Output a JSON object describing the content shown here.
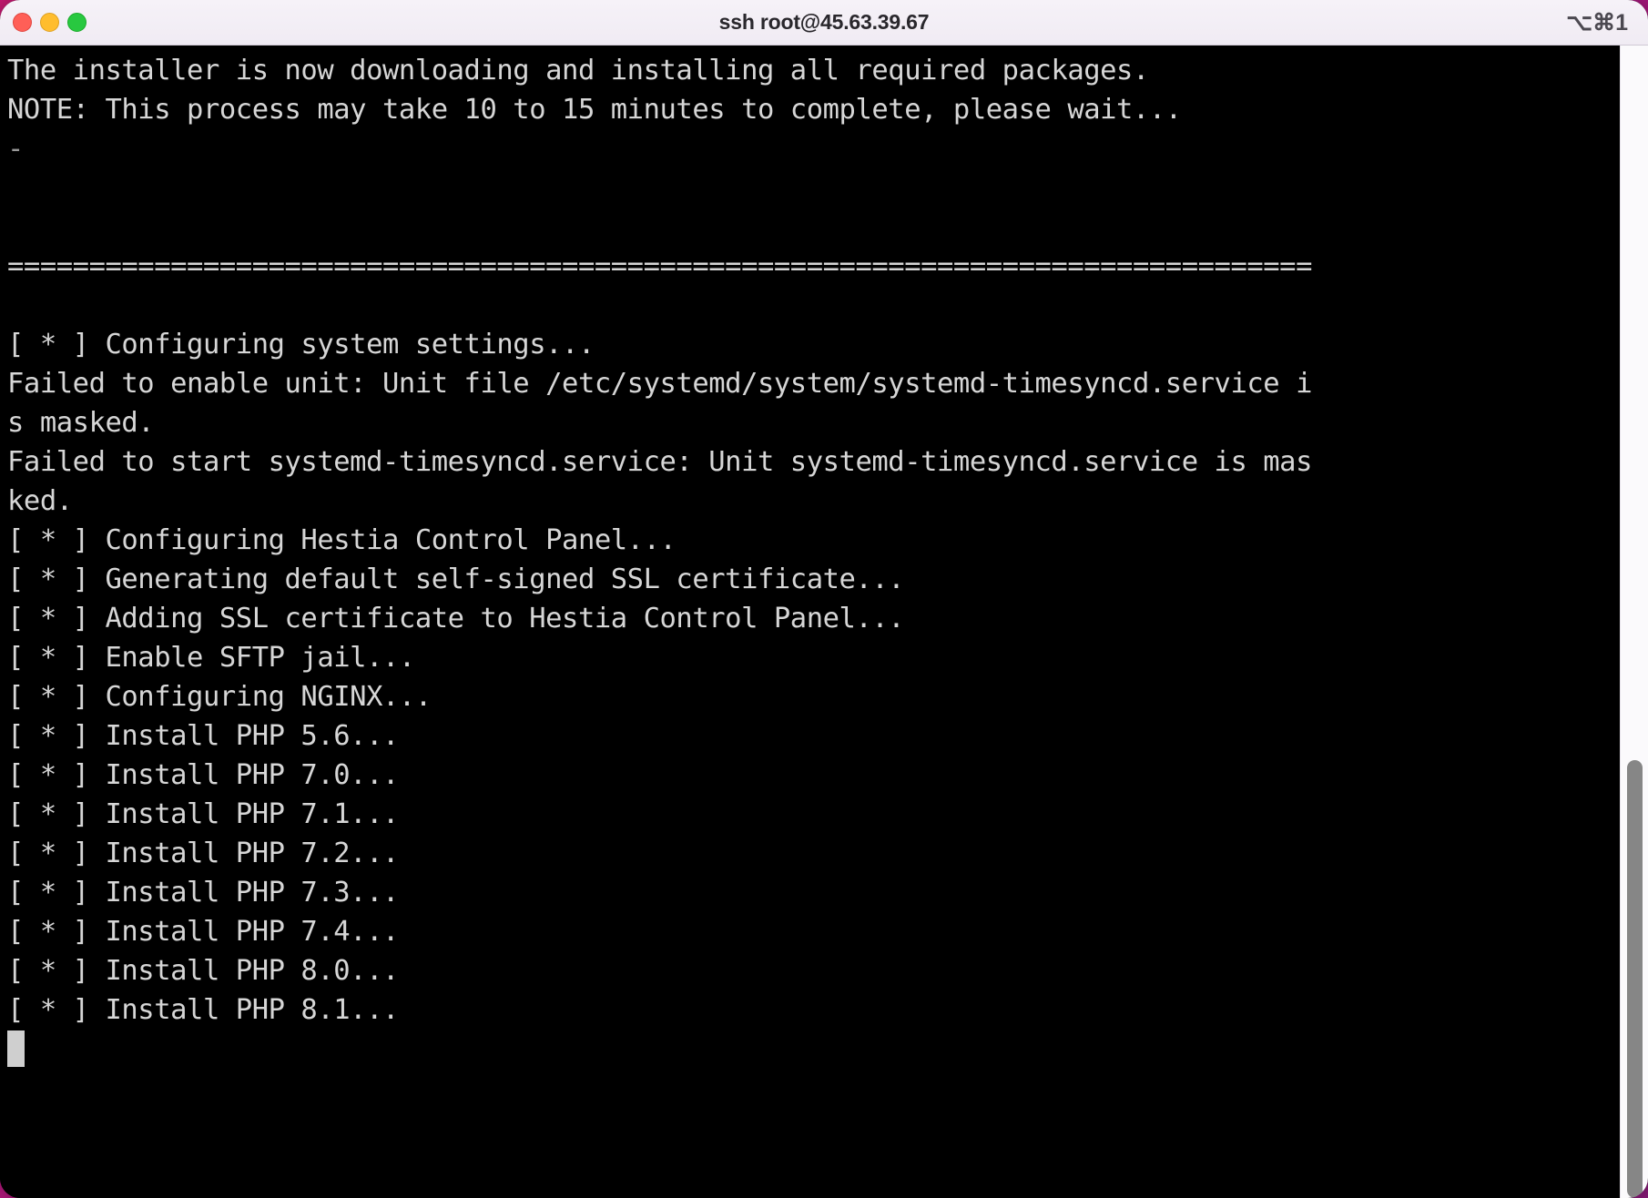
{
  "window": {
    "title": "ssh root@45.63.39.67",
    "shortcut": "⌥⌘1",
    "traffic_lights": [
      {
        "name": "close-button",
        "color": "#ff5f57"
      },
      {
        "name": "minimize-button",
        "color": "#ffbd2e"
      },
      {
        "name": "maximize-button",
        "color": "#28c840"
      }
    ]
  },
  "theme": {
    "terminal_background": "#000000",
    "terminal_foreground": "#d6d6d6",
    "titlebar_background": "#f2eef5",
    "cursor_color": "#cfcfcf",
    "scrollbar_thumb": "#868686",
    "desktop_background": "#c2186f"
  },
  "terminal": {
    "columns": 80,
    "lines": [
      {
        "text": "The installer is now downloading and installing all required packages.",
        "dim": false
      },
      {
        "text": "NOTE: This process may take 10 to 15 minutes to complete, please wait...",
        "dim": false
      },
      {
        "text": "-",
        "dim": true
      },
      {
        "text": "",
        "dim": false
      },
      {
        "text": "",
        "dim": false
      },
      {
        "text": "================================================================================",
        "dim": false
      },
      {
        "text": "",
        "dim": false
      },
      {
        "text": "[ * ] Configuring system settings...",
        "dim": false
      },
      {
        "text": "Failed to enable unit: Unit file /etc/systemd/system/systemd-timesyncd.service i",
        "dim": false
      },
      {
        "text": "s masked.",
        "dim": false
      },
      {
        "text": "Failed to start systemd-timesyncd.service: Unit systemd-timesyncd.service is mas",
        "dim": false
      },
      {
        "text": "ked.",
        "dim": false
      },
      {
        "text": "[ * ] Configuring Hestia Control Panel...",
        "dim": false
      },
      {
        "text": "[ * ] Generating default self-signed SSL certificate...",
        "dim": false
      },
      {
        "text": "[ * ] Adding SSL certificate to Hestia Control Panel...",
        "dim": false
      },
      {
        "text": "[ * ] Enable SFTP jail...",
        "dim": false
      },
      {
        "text": "[ * ] Configuring NGINX...",
        "dim": false
      },
      {
        "text": "[ * ] Install PHP 5.6...",
        "dim": false
      },
      {
        "text": "[ * ] Install PHP 7.0...",
        "dim": false
      },
      {
        "text": "[ * ] Install PHP 7.1...",
        "dim": false
      },
      {
        "text": "[ * ] Install PHP 7.2...",
        "dim": false
      },
      {
        "text": "[ * ] Install PHP 7.3...",
        "dim": false
      },
      {
        "text": "[ * ] Install PHP 7.4...",
        "dim": false
      },
      {
        "text": "[ * ] Install PHP 8.0...",
        "dim": false
      },
      {
        "text": "[ * ] Install PHP 8.1...",
        "dim": false
      }
    ],
    "cursor": {
      "row": 25,
      "col": 0,
      "style": "block"
    }
  },
  "scrollbar": {
    "orientation": "vertical",
    "thumb_top_pct": 62,
    "thumb_height_pct": 38
  }
}
